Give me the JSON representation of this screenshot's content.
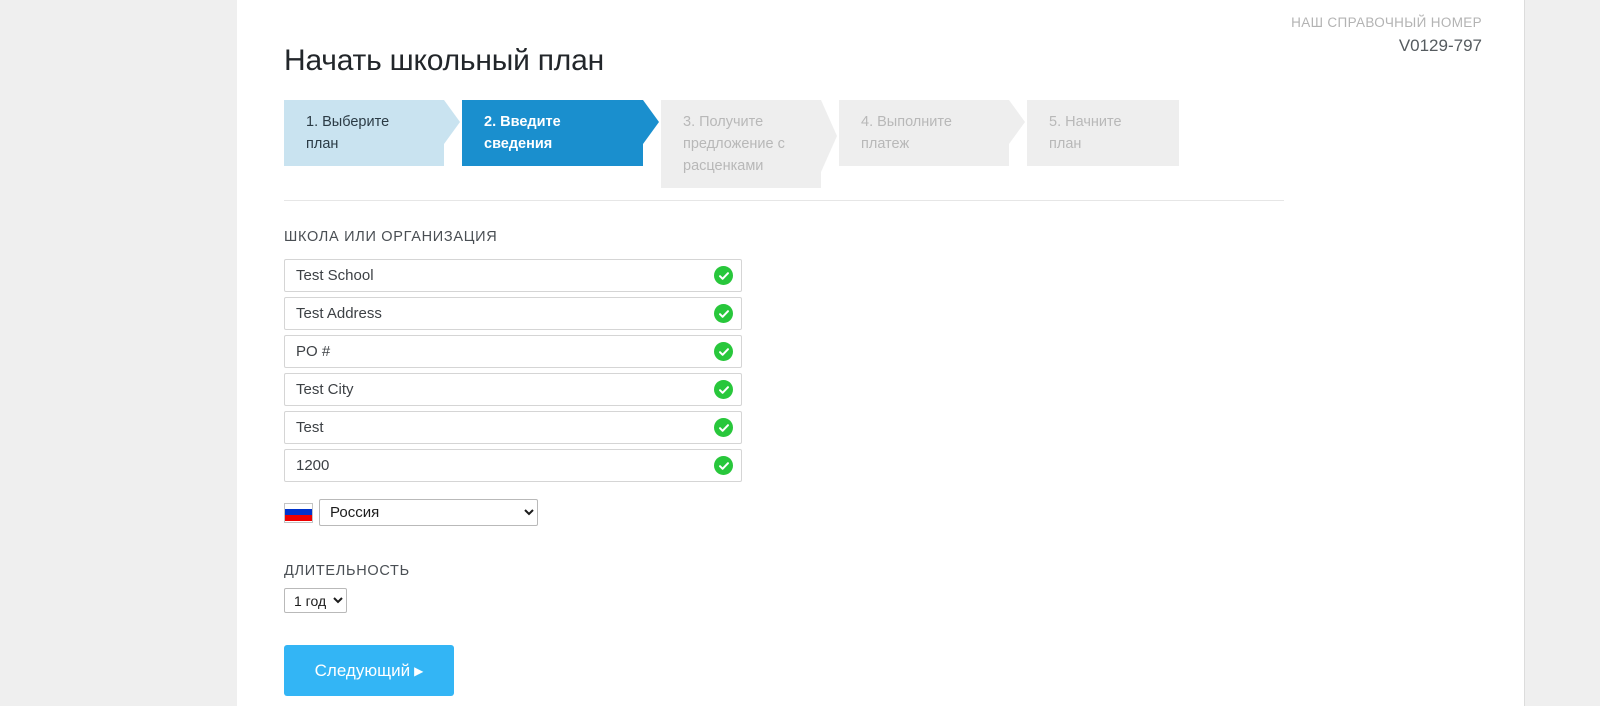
{
  "header": {
    "reference_label": "НАШ СПРАВОЧНЫЙ НОМЕР",
    "reference_value": "V0129-797"
  },
  "page_title": "Начать школьный план",
  "steps": [
    {
      "label": "1. Выберите план",
      "state": "done"
    },
    {
      "label": "2. Введите сведения",
      "state": "active"
    },
    {
      "label": "3. Получите предложение с расценками",
      "state": "pending"
    },
    {
      "label": "4. Выполните платеж",
      "state": "pending"
    },
    {
      "label": "5. Начните план",
      "state": "pending"
    }
  ],
  "form": {
    "section_label": "ШКОЛА ИЛИ ОРГАНИЗАЦИЯ",
    "fields": [
      {
        "name": "school-name",
        "value": "Test School",
        "placeholder": "Test School",
        "valid": true
      },
      {
        "name": "address",
        "value": "Test Address",
        "placeholder": "Test Address",
        "valid": true
      },
      {
        "name": "po-number",
        "value": "PO #",
        "placeholder": "PO #",
        "valid": true
      },
      {
        "name": "city",
        "value": "Test City",
        "placeholder": "Test City",
        "valid": true
      },
      {
        "name": "state",
        "value": "Test",
        "placeholder": "Test",
        "valid": true
      },
      {
        "name": "postal-code",
        "value": "1200",
        "placeholder": "1200",
        "valid": true
      }
    ],
    "country": {
      "selected": "Россия",
      "options": [
        "Россия"
      ],
      "flag": "flag-ru-icon"
    },
    "duration": {
      "label": "ДЛИТЕЛЬНОСТЬ",
      "selected": "1 год",
      "options": [
        "1 год"
      ]
    }
  },
  "actions": {
    "next_label": "Следующий",
    "next_caret": "▶"
  },
  "colors": {
    "page_background": "#efefef",
    "sheet_background": "#ffffff",
    "step_done": "#c9e3f0",
    "step_active": "#1a8fce",
    "step_pending": "#eeeeee",
    "button_primary": "#33b5f5",
    "valid_green": "#28c73b"
  }
}
